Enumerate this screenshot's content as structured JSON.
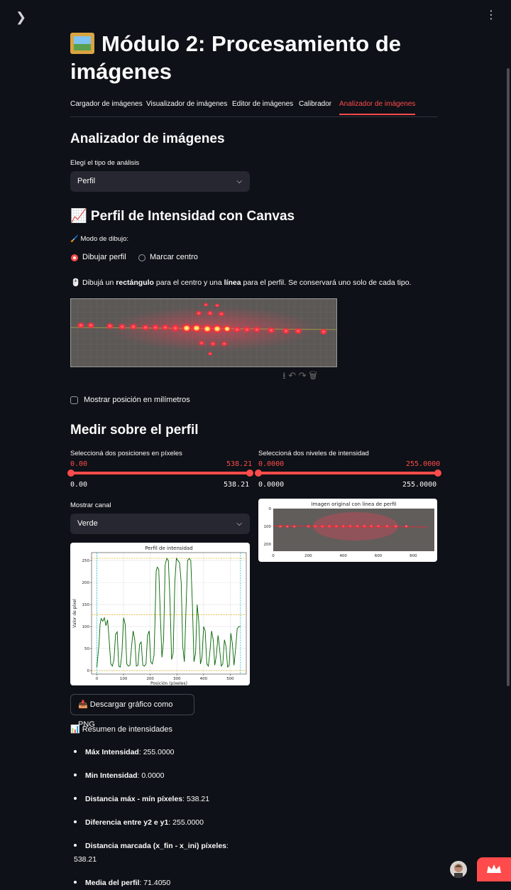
{
  "header": {
    "title": "Módulo 2: Procesamiento de imágenes",
    "title_icon": "framed-picture-emoji"
  },
  "tabs": [
    {
      "label": "Cargador de imágenes",
      "active": false
    },
    {
      "label": "Visualizador de imágenes",
      "active": false
    },
    {
      "label": "Editor de imágenes",
      "active": false
    },
    {
      "label": "Calibrador",
      "active": false
    },
    {
      "label": "Analizador de imágenes",
      "active": true
    }
  ],
  "analyzer": {
    "heading": "Analizador de imágenes",
    "analysis_type_label": "Elegí el tipo de análisis",
    "analysis_type_value": "Perfil"
  },
  "profile": {
    "heading": "📈 Perfil de Intensidad con Canvas",
    "mode_label": "🖌️ Modo de dibujo:",
    "mode_options": [
      {
        "label": "Dibujar perfil",
        "selected": true
      },
      {
        "label": "Marcar centro",
        "selected": false
      }
    ],
    "instr_prefix": "🖱️ Dibujá un ",
    "instr_b1": "rectángulo",
    "instr_mid": " para el centro y una ",
    "instr_b2": "línea",
    "instr_suffix": " para el perfil. Se conservará uno solo de cada tipo.",
    "show_mm_label": "Mostrar posición en milímetros",
    "show_mm_checked": false
  },
  "measure": {
    "heading": "Medir sobre el perfil",
    "positions": {
      "label": "Seleccioná dos posiciones en píxeles",
      "min": "0.00",
      "max": "538.21",
      "value_low": "0.00",
      "value_high": "538.21"
    },
    "levels": {
      "label": "Seleccioná dos niveles de intensidad",
      "min": "0.0000",
      "max": "255.0000",
      "value_low": "0.0000",
      "value_high": "255.0000"
    },
    "channel_label": "Mostrar canal",
    "channel_value": "Verde",
    "download_button": "📥 Descargar gráfico como PNG"
  },
  "chart_data": [
    {
      "type": "line",
      "title": "Perfil de intensidad",
      "xlabel": "Posición (píxeles)",
      "ylabel": "Valor de píxel",
      "xlim": [
        -20,
        560
      ],
      "ylim": [
        -8,
        268
      ],
      "xticks": [
        0,
        100,
        200,
        300,
        400,
        500
      ],
      "yticks": [
        0,
        50,
        100,
        150,
        200,
        250
      ],
      "series": [
        {
          "color": "#006400",
          "x": [
            0,
            8,
            12,
            16,
            22,
            28,
            34,
            40,
            46,
            52,
            58,
            64,
            70,
            76,
            82,
            88,
            94,
            100,
            106,
            112,
            118,
            124,
            130,
            136,
            142,
            148,
            154,
            160,
            166,
            172,
            178,
            184,
            190,
            196,
            202,
            208,
            214,
            218,
            222,
            226,
            232,
            238,
            244,
            250,
            256,
            262,
            268,
            274,
            280,
            286,
            292,
            298,
            304,
            310,
            316,
            322,
            328,
            334,
            340,
            346,
            352,
            358,
            364,
            370,
            376,
            382,
            388,
            394,
            400,
            406,
            412,
            418,
            424,
            430,
            436,
            442,
            448,
            454,
            460,
            466,
            472,
            478,
            484,
            490,
            496,
            502,
            508,
            514,
            520,
            526,
            532,
            538
          ],
          "values": [
            8,
            60,
            105,
            118,
            112,
            120,
            102,
            115,
            70,
            15,
            10,
            25,
            82,
            88,
            10,
            8,
            40,
            120,
            105,
            15,
            10,
            12,
            55,
            90,
            70,
            10,
            12,
            60,
            65,
            12,
            10,
            15,
            80,
            90,
            20,
            15,
            35,
            120,
            225,
            235,
            230,
            120,
            30,
            70,
            240,
            255,
            250,
            160,
            25,
            40,
            200,
            255,
            250,
            245,
            200,
            55,
            20,
            140,
            250,
            255,
            250,
            150,
            20,
            40,
            150,
            110,
            15,
            30,
            100,
            90,
            15,
            10,
            45,
            90,
            70,
            12,
            35,
            80,
            50,
            10,
            15,
            70,
            55,
            8,
            12,
            85,
            60,
            12,
            50,
            95,
            100,
            100
          ]
        }
      ],
      "hlines": [
        {
          "y": 255,
          "color": "#e0a800"
        },
        {
          "y": 127,
          "color": "#e0a800"
        },
        {
          "y": 0,
          "color": "#e0a800"
        }
      ],
      "vlines": [
        {
          "x": 0,
          "color": "#00bcd4"
        },
        {
          "x": 538.21,
          "color": "#00bcd4"
        }
      ]
    },
    {
      "type": "image",
      "title": "Imagen original con línea de perfil",
      "xticks": [
        0,
        200,
        400,
        600,
        800
      ],
      "yticks": [
        0,
        100,
        200
      ],
      "xlim": [
        0,
        920
      ],
      "ylim": [
        240,
        0
      ]
    }
  ],
  "summary": {
    "heading": "📊 Resumen de intensidades",
    "items": [
      {
        "label": "Máx Intensidad",
        "value": "255.0000"
      },
      {
        "label": "Min Intensidad",
        "value": "0.0000"
      },
      {
        "label": "Distancia máx - mín píxeles",
        "value": "538.21"
      },
      {
        "label": "Diferencia entre y2 e y1",
        "value": "255.0000"
      },
      {
        "label": "Distancia marcada (x_fin - x_ini) píxeles",
        "value": "538.21"
      },
      {
        "label": "Media del perfil",
        "value": "71.4050"
      }
    ]
  },
  "colors": {
    "background": "#0e1117",
    "accent": "#ff4b4b",
    "widget_bg": "#262730"
  }
}
